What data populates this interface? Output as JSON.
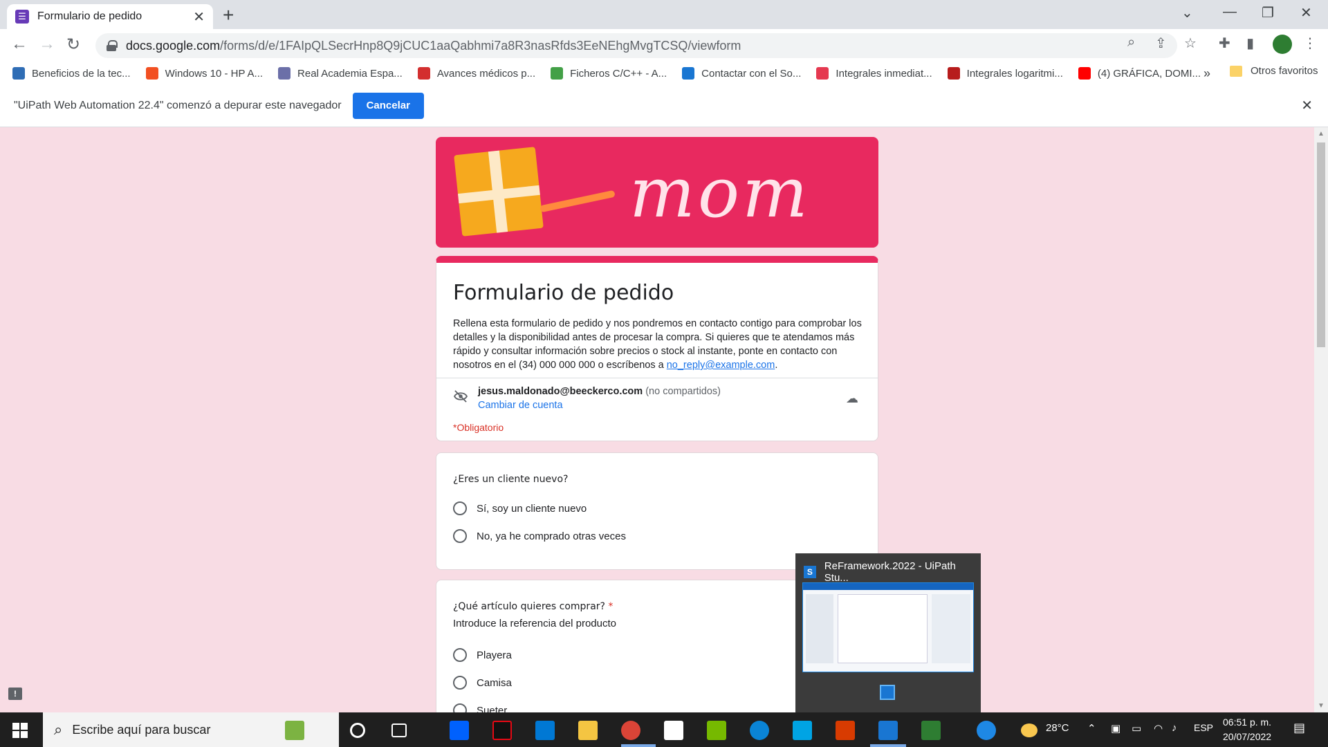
{
  "browser": {
    "tab_title": "Formulario de pedido",
    "url_host": "docs.google.com",
    "url_path": "/forms/d/e/1FAIpQLSecrHnp8Q9jCUC1aaQabhmi7a8R3nasRfds3EeNEhgMvgTCSQ/viewform",
    "bookmarks": [
      {
        "label": "Beneficios de la tec...",
        "color": "#2f6db5"
      },
      {
        "label": "Windows 10 - HP A...",
        "color": "#f25022"
      },
      {
        "label": "Real Academia Espa...",
        "color": "#6b6fa8"
      },
      {
        "label": "Avances médicos p...",
        "color": "#d32f2f"
      },
      {
        "label": "Ficheros C/C++ - A...",
        "color": "#43a047"
      },
      {
        "label": "Contactar con el So...",
        "color": "#1976d2"
      },
      {
        "label": "Integrales inmediat...",
        "color": "#e53950"
      },
      {
        "label": "Integrales logaritmi...",
        "color": "#b71c1c"
      },
      {
        "label": "(4) GRÁFICA, DOMI...",
        "color": "#ff0000"
      }
    ],
    "bookmarks_more": "»",
    "other_favorites": "Otros favoritos"
  },
  "infobar": {
    "message": "\"UiPath Web Automation 22.4\" comenzó a depurar este navegador",
    "cancel_label": "Cancelar"
  },
  "banner": {
    "word": "mom"
  },
  "form": {
    "title": "Formulario de pedido",
    "description": "Rellena esta formulario de pedido y nos pondremos en contacto contigo para comprobar los detalles y la disponibilidad antes de procesar la compra. Si quieres que te atendamos más rápido y consultar información sobre precios o stock al instante, ponte en contacto con nosotros en el (34) 000 000 000 o escríbenos a ",
    "description_link": "no_reply@example.com",
    "description_end": ".",
    "account_email": "jesus.maldonado@beeckerco.com",
    "account_not_shared": "(no compartidos)",
    "switch_account": "Cambiar de cuenta",
    "required_note": "*Obligatorio"
  },
  "questions": [
    {
      "title": "¿Eres un cliente nuevo?",
      "options": [
        "Sí, soy un cliente nuevo",
        "No, ya he comprado otras veces"
      ]
    },
    {
      "title": "¿Qué artículo quieres comprar?",
      "required_mark": "*",
      "subtitle": "Introduce la referencia del producto",
      "options": [
        "Playera",
        "Camisa",
        "Sueter"
      ]
    }
  ],
  "preview": {
    "title": "ReFramework.2022 - UiPath Stu..."
  },
  "taskbar": {
    "search_placeholder": "Escribe aquí para buscar",
    "weather": "28°C",
    "language": "ESP",
    "time": "06:51 p. m.",
    "date": "20/07/2022"
  }
}
